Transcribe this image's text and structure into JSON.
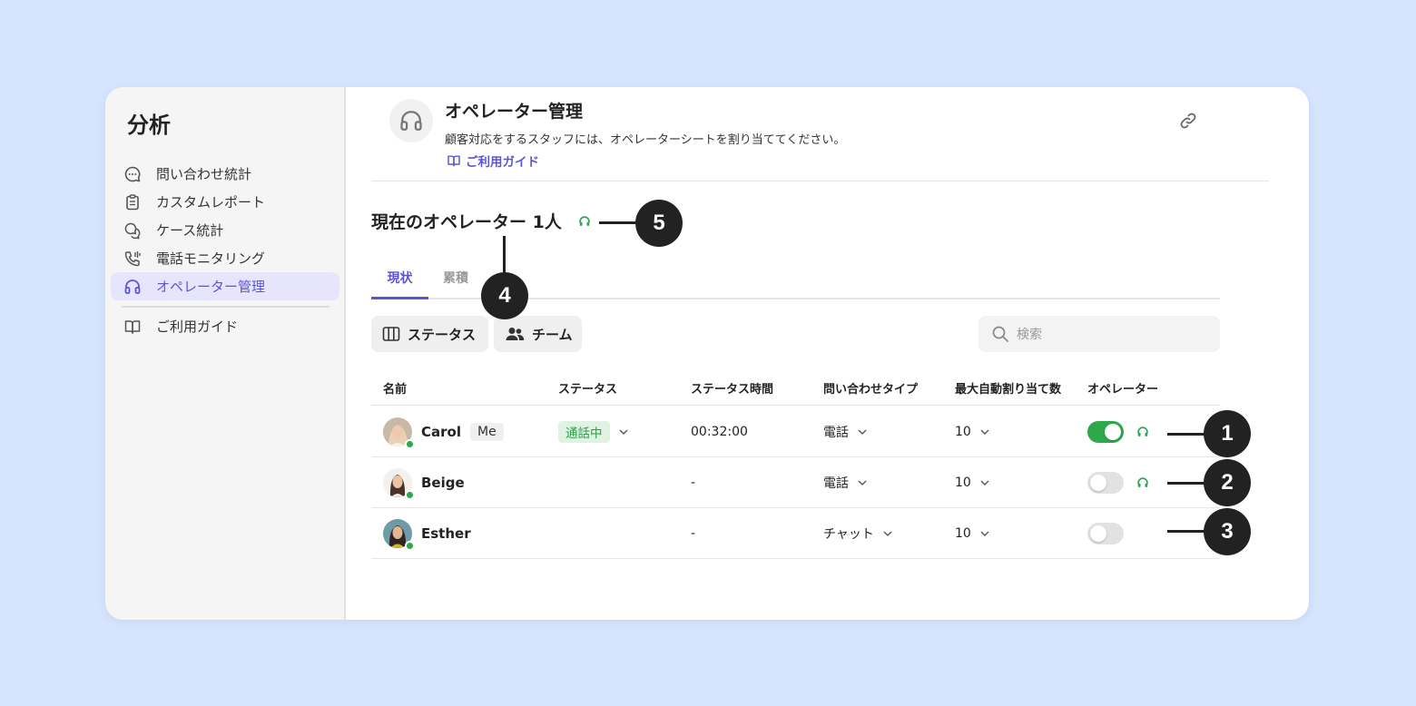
{
  "sidebar": {
    "title": "分析",
    "items": [
      {
        "label": "問い合わせ統計",
        "icon": "chat-bubble-icon"
      },
      {
        "label": "カスタムレポート",
        "icon": "clipboard-icon"
      },
      {
        "label": "ケース統計",
        "icon": "chat-bubbles-icon"
      },
      {
        "label": "電話モニタリング",
        "icon": "phone-icon"
      },
      {
        "label": "オペレーター管理",
        "icon": "headset-icon",
        "active": true
      },
      {
        "label": "ご利用ガイド",
        "icon": "book-icon"
      }
    ]
  },
  "header": {
    "title": "オペレーター管理",
    "description": "顧客対応をするスタッフには、オペレーターシートを割り当ててください。",
    "guide_link": "ご利用ガイド"
  },
  "section": {
    "title": "現在のオペレーター 1人"
  },
  "tabs": [
    {
      "label": "現状",
      "active": true
    },
    {
      "label": "累積",
      "active": false
    }
  ],
  "filters": {
    "status_label": "ステータス",
    "team_label": "チーム"
  },
  "search": {
    "placeholder": "検索"
  },
  "table": {
    "columns": [
      "名前",
      "ステータス",
      "ステータス時間",
      "問い合わせタイプ",
      "最大自動割り当て数",
      "オペレーター"
    ],
    "rows": [
      {
        "name": "Carol",
        "badge": "Me",
        "status": "通話中",
        "status_time": "00:32:00",
        "inquiry_type": "電話",
        "max_assign": "10",
        "operator_on": true,
        "headset": true
      },
      {
        "name": "Beige",
        "badge": "",
        "status": "",
        "status_time": "-",
        "inquiry_type": "電話",
        "max_assign": "10",
        "operator_on": false,
        "headset": true
      },
      {
        "name": "Esther",
        "badge": "",
        "status": "",
        "status_time": "-",
        "inquiry_type": "チャット",
        "max_assign": "10",
        "operator_on": false,
        "headset": false
      }
    ]
  },
  "callouts": [
    "1",
    "2",
    "3",
    "4",
    "5"
  ],
  "colors": {
    "accent": "#5b55d6",
    "online": "#2ea84a",
    "background": "#d6e4fe"
  }
}
